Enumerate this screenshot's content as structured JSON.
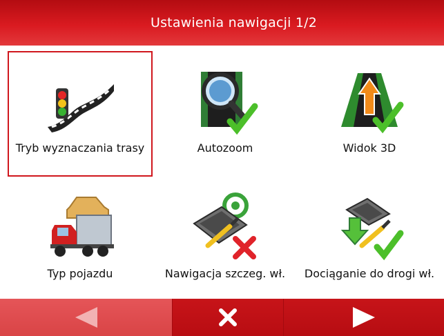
{
  "header": {
    "title": "Ustawienia nawigacji 1/2"
  },
  "tiles": [
    {
      "label": "Tryb wyznaczania trasy",
      "icon": "route-road-icon",
      "selected": true
    },
    {
      "label": "Autozoom",
      "icon": "magnifier-check-icon"
    },
    {
      "label": "Widok 3D",
      "icon": "perspective-arrow-check-icon"
    },
    {
      "label": "Typ pojazdu",
      "icon": "truck-car-icon"
    },
    {
      "label": "Nawigacja szczeg. wł.",
      "icon": "gps-device-cross-icon"
    },
    {
      "label": "Dociąganie do drogi wł.",
      "icon": "gps-device-check-icon"
    }
  ],
  "footer": {
    "prev_icon": "left-arrow-icon",
    "close_icon": "close-x-icon",
    "next_icon": "right-arrow-icon"
  },
  "colors": {
    "accent": "#d91a20",
    "check": "#4cbf2a",
    "cross": "#e0232a"
  }
}
